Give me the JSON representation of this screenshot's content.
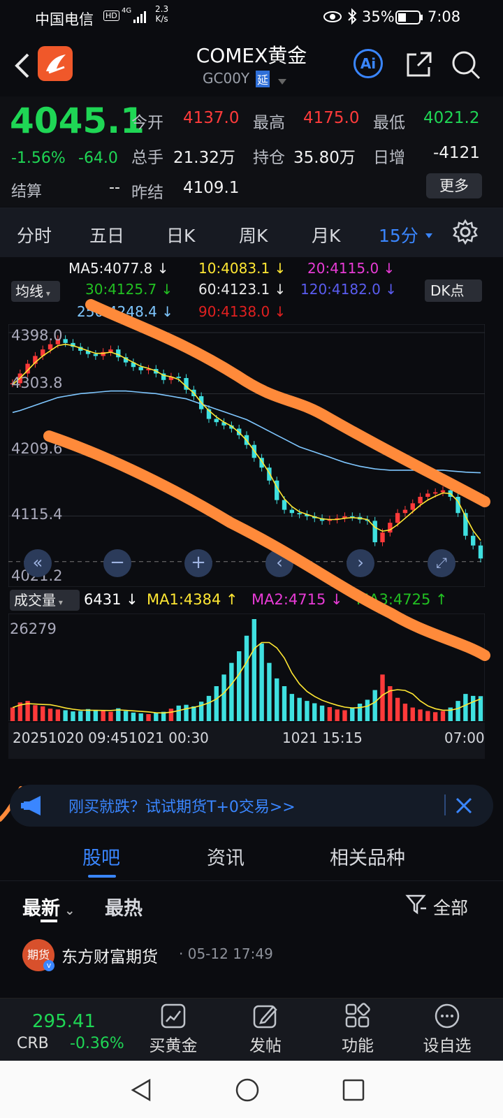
{
  "status": {
    "carrier": "中国电信",
    "hd": "HD",
    "network": "4G",
    "speed_val": "2.3",
    "speed_unit": "K/s",
    "battery_pct": "35%",
    "time": "7:08"
  },
  "header": {
    "title": "COMEX黄金",
    "subtitle": "GC00Y",
    "delay_badge": "延",
    "ai_label": "Ai"
  },
  "quote": {
    "price": "4045.1",
    "change_pct": "-1.56%",
    "change_val": "-64.0",
    "open_label": "今开",
    "open": "4137.0",
    "high_label": "最高",
    "high": "4175.0",
    "low_label": "最低",
    "low": "4021.2",
    "volume_label": "总手",
    "volume": "21.32万",
    "oi_label": "持仓",
    "oi": "35.80万",
    "daily_inc_label": "日增",
    "daily_inc": "-4121",
    "settle_label": "结算",
    "settle": "--",
    "prev_settle_label": "昨结",
    "prev_settle": "4109.1",
    "more_label": "更多"
  },
  "period_tabs": [
    "分时",
    "五日",
    "日K",
    "周K",
    "月K",
    "15分"
  ],
  "ma_legend": {
    "ma_button": "均线",
    "dk_button": "DK点",
    "ma5": "MA5:4077.8 ↓",
    "ma10": "10:4083.1 ↓",
    "ma20": "20:4115.0 ↓",
    "ma30": "30:4125.7 ↓",
    "ma60": "60:4123.1 ↓",
    "ma120": "120:4182.0 ↓",
    "ma250": "250:4248.4 ↓",
    "ma90": "90:4138.0 ↓"
  },
  "price_axis": [
    "4398.0",
    "4303.8",
    "4209.6",
    "4115.4",
    "4021.2"
  ],
  "volume_legend": {
    "vol_button": "成交量",
    "vol": "6431 ↓",
    "ma1": "MA1:4384 ↑",
    "ma2": "MA2:4715 ↓",
    "ma3": "MA3:4725 ↑",
    "max": "26279"
  },
  "time_axis": [
    "20251020 09:45",
    "1021 00:30",
    "1021 15:15",
    "07:00"
  ],
  "colors": {
    "ma5": "#f2f2f2",
    "ma10": "#ffe733",
    "ma20": "#e83bd6",
    "ma30": "#22c022",
    "ma60": "#e8e8e8",
    "ma120": "#5a5cf0",
    "ma250": "#7fc7ff",
    "ma90": "#e02020",
    "up": "#ff3a3a",
    "down": "#3fe0e0",
    "accent": "#3a86ff",
    "annotation": "#ff8a3a"
  },
  "chart_data": {
    "type": "line",
    "title": "",
    "ylim": [
      4021.2,
      4398.0
    ],
    "close": [
      4320,
      4335,
      4350,
      4362,
      4372,
      4380,
      4388,
      4382,
      4376,
      4370,
      4365,
      4362,
      4368,
      4372,
      4360,
      4352,
      4345,
      4340,
      4342,
      4335,
      4325,
      4330,
      4328,
      4310,
      4300,
      4280,
      4265,
      4260,
      4255,
      4250,
      4240,
      4225,
      4205,
      4190,
      4170,
      4140,
      4125,
      4120,
      4118,
      4115,
      4112,
      4108,
      4110,
      4112,
      4115,
      4114,
      4110,
      4108,
      4075,
      4090,
      4105,
      4120,
      4125,
      4135,
      4145,
      4150,
      4152,
      4155,
      4145,
      4120,
      4085,
      4070,
      4050
    ],
    "volume": [
      3500,
      4800,
      5200,
      4100,
      3800,
      3200,
      3000,
      2800,
      2500,
      2600,
      3100,
      2900,
      2700,
      2400,
      3300,
      2600,
      2200,
      2000,
      1800,
      2100,
      2400,
      3200,
      4000,
      4200,
      3800,
      5000,
      6500,
      9000,
      12000,
      15000,
      18000,
      22000,
      26279,
      20000,
      15000,
      11000,
      9000,
      7000,
      6000,
      5200,
      4600,
      4000,
      3600,
      3000,
      2800,
      3500,
      4500,
      5500,
      8000,
      12000,
      9000,
      6000,
      4500,
      3500,
      3000,
      2600,
      2300,
      2600,
      3500,
      5200,
      7000,
      6500,
      6431
    ],
    "ma5": [
      4318,
      4328,
      4340,
      4352,
      4362,
      4370,
      4378,
      4380,
      4378,
      4374,
      4370,
      4366,
      4366,
      4368,
      4364,
      4358,
      4352,
      4346,
      4343,
      4339,
      4332,
      4330,
      4326,
      4315,
      4305,
      4290,
      4278,
      4268,
      4260,
      4254,
      4244,
      4232,
      4216,
      4200,
      4182,
      4160,
      4142,
      4130,
      4122,
      4118,
      4114,
      4111,
      4110,
      4110,
      4112,
      4113,
      4112,
      4110,
      4098,
      4092,
      4094,
      4102,
      4112,
      4122,
      4132,
      4140,
      4146,
      4151,
      4150,
      4138,
      4115,
      4093,
      4077.8
    ],
    "ma120": [
      4275,
      4278,
      4282,
      4286,
      4290,
      4294,
      4298,
      4300,
      4302,
      4304,
      4305,
      4306,
      4307,
      4308,
      4308,
      4308,
      4307,
      4306,
      4305,
      4304,
      4302,
      4300,
      4298,
      4296,
      4292,
      4288,
      4284,
      4280,
      4276,
      4272,
      4268,
      4264,
      4258,
      4252,
      4246,
      4240,
      4234,
      4228,
      4222,
      4218,
      4214,
      4210,
      4206,
      4202,
      4198,
      4195,
      4192,
      4190,
      4188,
      4187,
      4186,
      4186,
      4186,
      4186,
      4186,
      4186,
      4186,
      4186,
      4185,
      4184,
      4183,
      4182.5,
      4182.0
    ]
  },
  "banner": {
    "text": "刚买就跌？试试期货T+0交易>>"
  },
  "sub_tabs": [
    "股吧",
    "资讯",
    "相关品种"
  ],
  "filters": {
    "latest": "最新",
    "hot": "最热",
    "all": "全部"
  },
  "post": {
    "author": "东方财富期货",
    "time": "· 05-12 17:49",
    "avatar_text": "期货"
  },
  "bottom": {
    "crb_value": "295.41",
    "crb_label": "CRB",
    "crb_change": "-0.36%",
    "buy_gold": "买黄金",
    "post": "发帖",
    "functions": "功能",
    "watchlist": "设自选"
  }
}
